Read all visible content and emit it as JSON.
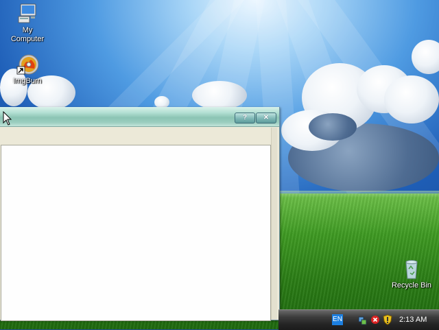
{
  "desktop": {
    "icons": [
      {
        "label_line1": "My",
        "label_line2": "Computer",
        "icon": "computer-icon"
      },
      {
        "label": "ImgBurn",
        "icon": "imgburn-icon"
      },
      {
        "label": "Recycle Bin",
        "icon": "recycle-bin-icon"
      }
    ]
  },
  "window": {
    "title": "",
    "help_button": "?",
    "close_button": "✕"
  },
  "taskbar": {
    "language": "EN",
    "tray_icons": [
      "network-icon",
      "error-icon",
      "security-shield-icon"
    ],
    "clock": "2:13 AM"
  },
  "colors": {
    "sky": "#1f5fb8",
    "grass": "#3f9b23",
    "titlebar": "#9bcdbf",
    "taskbar": "#252525",
    "language_box": "#1c7fe0"
  }
}
